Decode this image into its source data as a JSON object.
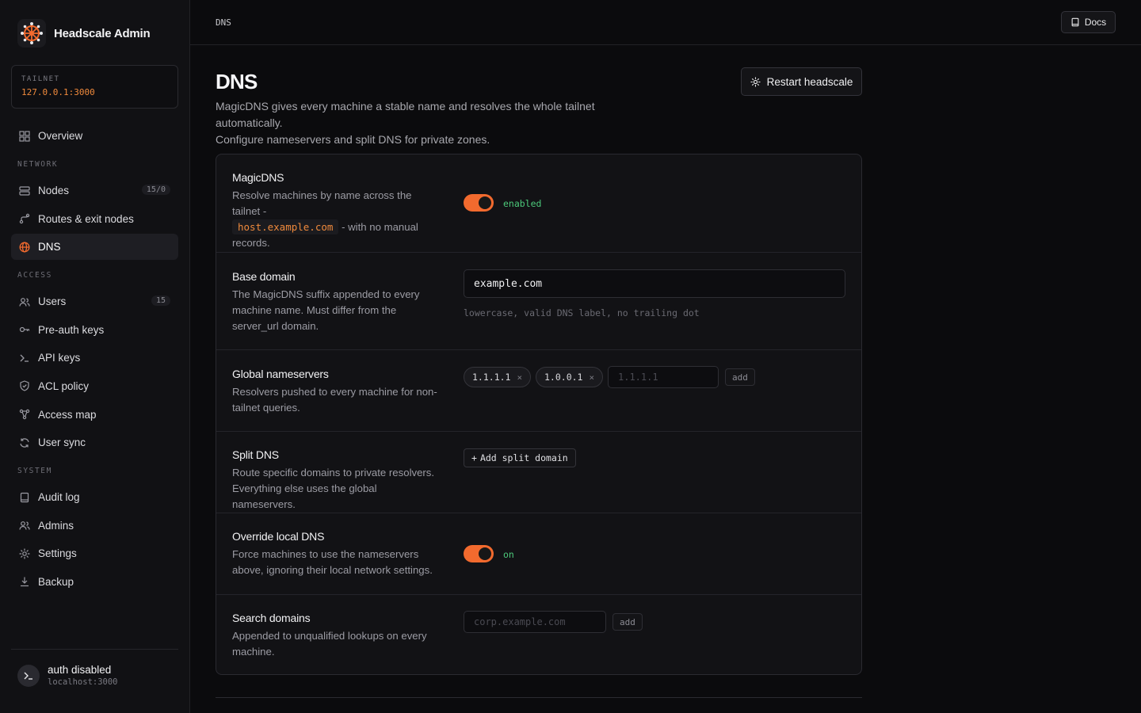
{
  "brand": {
    "name": "Headscale Admin"
  },
  "tailnet": {
    "label": "TAILNET",
    "value": "127.0.0.1:3000"
  },
  "nav": {
    "overview": "Overview",
    "section_network": "NETWORK",
    "nodes": "Nodes",
    "nodes_badge": "15/0",
    "routes": "Routes & exit nodes",
    "dns": "DNS",
    "section_access": "ACCESS",
    "users": "Users",
    "users_badge": "15",
    "preauth": "Pre-auth keys",
    "apikeys": "API keys",
    "acl": "ACL policy",
    "accessmap": "Access map",
    "usersync": "User sync",
    "section_system": "SYSTEM",
    "audit": "Audit log",
    "admins": "Admins",
    "settings": "Settings",
    "backup": "Backup"
  },
  "footer": {
    "title": "auth disabled",
    "subtitle": "localhost:3000"
  },
  "topbar": {
    "breadcrumb": "DNS",
    "docs": "Docs"
  },
  "page": {
    "title": "DNS",
    "description_line1": "MagicDNS gives every machine a stable name and resolves the whole tailnet automatically.",
    "description_line2": "Configure nameservers and split DNS for private zones.",
    "restart": "Restart headscale"
  },
  "magicdns": {
    "title": "MagicDNS",
    "desc_a": "Resolve machines by name across the tailnet -",
    "code": "host.example.com",
    "desc_b": " - with no manual records.",
    "toggle_on": true,
    "status": "enabled"
  },
  "base_domain": {
    "title": "Base domain",
    "desc": "The MagicDNS suffix appended to every machine name. Must differ from the server_url domain.",
    "value": "example.com",
    "hint": "lowercase, valid DNS label, no trailing dot"
  },
  "global_ns": {
    "title": "Global nameservers",
    "desc": "Resolvers pushed to every machine for non-tailnet queries.",
    "servers": [
      "1.1.1.1",
      "1.0.0.1"
    ],
    "placeholder": "1.1.1.1",
    "add": "add",
    "remove": "×"
  },
  "split_dns": {
    "title": "Split DNS",
    "desc": "Route specific domains to private resolvers. Everything else uses the global nameservers.",
    "button": "Add split domain",
    "button_prefix": "+"
  },
  "override": {
    "title": "Override local DNS",
    "desc": "Force machines to use the nameservers above, ignoring their local network settings.",
    "toggle_on": true,
    "status": "on"
  },
  "search_domains": {
    "title": "Search domains",
    "desc": "Appended to unqualified lookups on every machine.",
    "placeholder": "corp.example.com",
    "add": "add"
  },
  "colors": {
    "accent": "#f26a2e",
    "success": "#4cc97a",
    "code": "#f08a3c"
  }
}
